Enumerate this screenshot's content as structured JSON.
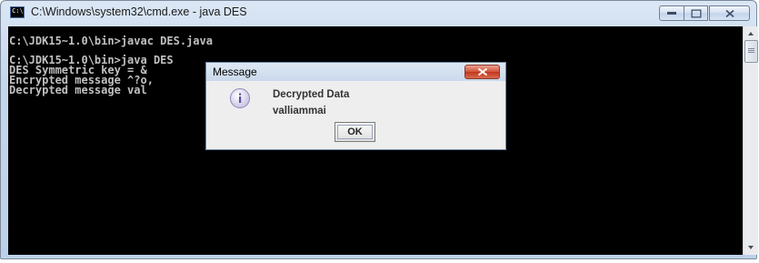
{
  "window": {
    "title": "C:\\Windows\\system32\\cmd.exe - java  DES",
    "icon_text": "C:\\"
  },
  "console": {
    "lines": [
      "C:\\JDK15~1.0\\bin>javac DES.java",
      "C:\\JDK15~1.0\\bin>java DES",
      "DES Symmetric key = &",
      "Encrypted message ^?o,",
      "Decrypted message val"
    ],
    "text_color": "#c0c0c0",
    "background": "#000000"
  },
  "dialog": {
    "title": "Message",
    "message_line1": "Decrypted Data",
    "message_line2": "valliammai",
    "ok_label": "OK",
    "icon": "info-icon"
  },
  "colors": {
    "close_button": "#c2371f",
    "titlebar": "#c6d7ec"
  }
}
